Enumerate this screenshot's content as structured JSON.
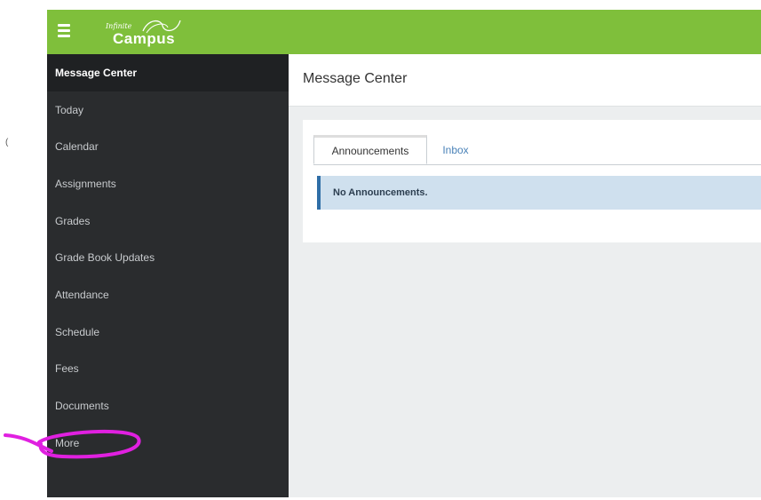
{
  "app": {
    "logo_small": "Infinite",
    "logo_big": "Campus",
    "accent_color": "#7fbf3b"
  },
  "sidebar": {
    "items": [
      {
        "label": "Message Center",
        "active": true
      },
      {
        "label": "Today"
      },
      {
        "label": "Calendar"
      },
      {
        "label": "Assignments"
      },
      {
        "label": "Grades"
      },
      {
        "label": "Grade Book Updates"
      },
      {
        "label": "Attendance"
      },
      {
        "label": "Schedule"
      },
      {
        "label": "Fees"
      },
      {
        "label": "Documents"
      },
      {
        "label": "More"
      }
    ]
  },
  "main": {
    "title": "Message Center",
    "tabs": [
      {
        "label": "Announcements",
        "active": true
      },
      {
        "label": "Inbox"
      }
    ],
    "alert_text": "No Announcements."
  },
  "icons": {
    "menu": "hamburger-menu-icon",
    "logo": "infinite-campus-logo"
  },
  "annotation": {
    "color": "#e020e0",
    "target": "More"
  }
}
